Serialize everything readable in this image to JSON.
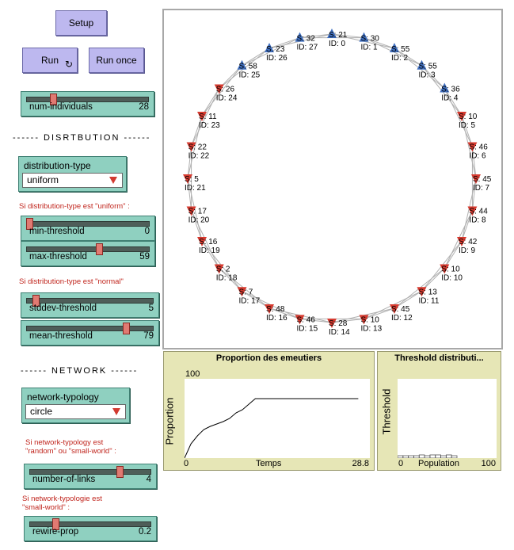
{
  "buttons": {
    "setup": "Setup",
    "run": "Run",
    "run_once": "Run once"
  },
  "sliders": {
    "num_individuals": {
      "label": "num-individuals",
      "value": "28",
      "fraction": 0.2
    },
    "min_threshold": {
      "label": "min-threshold",
      "value": "0",
      "fraction": 0.0
    },
    "max_threshold": {
      "label": "max-threshold",
      "value": "59",
      "fraction": 0.59
    },
    "stddev_threshold": {
      "label": "stddev-threshold",
      "value": "5",
      "fraction": 0.05
    },
    "mean_threshold": {
      "label": "mean-threshold",
      "value": "79",
      "fraction": 0.79
    },
    "number_of_links": {
      "label": "number-of-links",
      "value": "4",
      "fraction": 0.75
    },
    "rewire_prop": {
      "label": "rewire-prop",
      "value": "0.2",
      "fraction": 0.2
    }
  },
  "sections": {
    "distribution": "------ DISRTBUTION ------",
    "network": "------ NETWORK ------"
  },
  "choosers": {
    "distribution": {
      "label": "distribution-type",
      "value": "uniform"
    },
    "network": {
      "label": "network-typology",
      "value": "circle"
    }
  },
  "notes": {
    "uniform": "Si distribution-type est \"uniform\" :",
    "normal": "Si distribution-type est \"normal\"",
    "random": "Si network-typology est\n\"random\" ou \"small-world\" :",
    "small": "Si network-typologie est\n\"small-world\" :"
  },
  "colors": {
    "red": "#d63a2f",
    "blue": "#3f6fc0",
    "link": "#b0b0b0"
  },
  "agents": [
    {
      "id": "ID: 0",
      "s": "S: 21",
      "c": "blue"
    },
    {
      "id": "ID: 1",
      "s": "S: 30",
      "c": "blue"
    },
    {
      "id": "ID: 2",
      "s": "S: 55",
      "c": "blue"
    },
    {
      "id": "ID: 3",
      "s": "S: 55",
      "c": "blue"
    },
    {
      "id": "ID: 4",
      "s": "S: 36",
      "c": "blue"
    },
    {
      "id": "ID: 5",
      "s": "S: 10",
      "c": "red"
    },
    {
      "id": "ID: 6",
      "s": "S: 46",
      "c": "red"
    },
    {
      "id": "ID: 7",
      "s": "S: 45",
      "c": "red"
    },
    {
      "id": "ID: 8",
      "s": "S: 44",
      "c": "red"
    },
    {
      "id": "ID: 9",
      "s": "S: 42",
      "c": "red"
    },
    {
      "id": "ID: 10",
      "s": "S: 10",
      "c": "red"
    },
    {
      "id": "ID: 11",
      "s": "S: 13",
      "c": "red"
    },
    {
      "id": "ID: 12",
      "s": "S: 45",
      "c": "red"
    },
    {
      "id": "ID: 13",
      "s": "S: 10",
      "c": "red"
    },
    {
      "id": "ID: 14",
      "s": "S: 28",
      "c": "red"
    },
    {
      "id": "ID: 15",
      "s": "S: 46",
      "c": "red"
    },
    {
      "id": "ID: 16",
      "s": "S: 48",
      "c": "red"
    },
    {
      "id": "ID: 17",
      "s": "S: 7",
      "c": "red"
    },
    {
      "id": "ID: 18",
      "s": "S: 2",
      "c": "red"
    },
    {
      "id": "ID: 19",
      "s": "S: 16",
      "c": "red"
    },
    {
      "id": "ID: 20",
      "s": "S: 17",
      "c": "red"
    },
    {
      "id": "ID: 21",
      "s": "S: 5",
      "c": "red"
    },
    {
      "id": "ID: 22",
      "s": "S: 22",
      "c": "red"
    },
    {
      "id": "ID: 23",
      "s": "S: 11",
      "c": "red"
    },
    {
      "id": "ID: 24",
      "s": "S: 26",
      "c": "red"
    },
    {
      "id": "ID: 25",
      "s": "S: 58",
      "c": "blue"
    },
    {
      "id": "ID: 26",
      "s": "S: 23",
      "c": "blue"
    },
    {
      "id": "ID: 27",
      "s": "S: 32",
      "c": "blue"
    }
  ],
  "plot_proportion": {
    "title": "Proportion des emeutiers",
    "xlabel": "Temps",
    "ylabel": "Proportion",
    "xmin": "0",
    "xmax": "28.8",
    "ymax": "100",
    "chart_data": {
      "type": "line",
      "x": [
        0,
        1,
        2,
        3,
        4,
        5,
        6,
        7,
        8,
        9,
        10,
        11,
        12,
        13,
        14,
        15,
        16,
        17,
        18,
        19,
        20,
        21,
        22,
        23,
        24,
        25,
        26,
        27
      ],
      "y": [
        0,
        18,
        28,
        36,
        40,
        43,
        46,
        50,
        57,
        61,
        68,
        75,
        75,
        75,
        75,
        75,
        75,
        75,
        75,
        75,
        75,
        75,
        75,
        75,
        75,
        75,
        75,
        75
      ],
      "xlim": [
        0,
        28.8
      ],
      "ylim": [
        0,
        100
      ]
    }
  },
  "plot_threshold": {
    "title": "Threshold distributi...",
    "xlabel": "Population",
    "ylabel": "Threshold",
    "xmin": "0",
    "xmax": "100",
    "ymax": "",
    "chart_data": {
      "type": "bar",
      "values": [
        3,
        3,
        3,
        3,
        4,
        3,
        4,
        4,
        3,
        4,
        3
      ],
      "ylim": [
        0,
        100
      ]
    }
  }
}
